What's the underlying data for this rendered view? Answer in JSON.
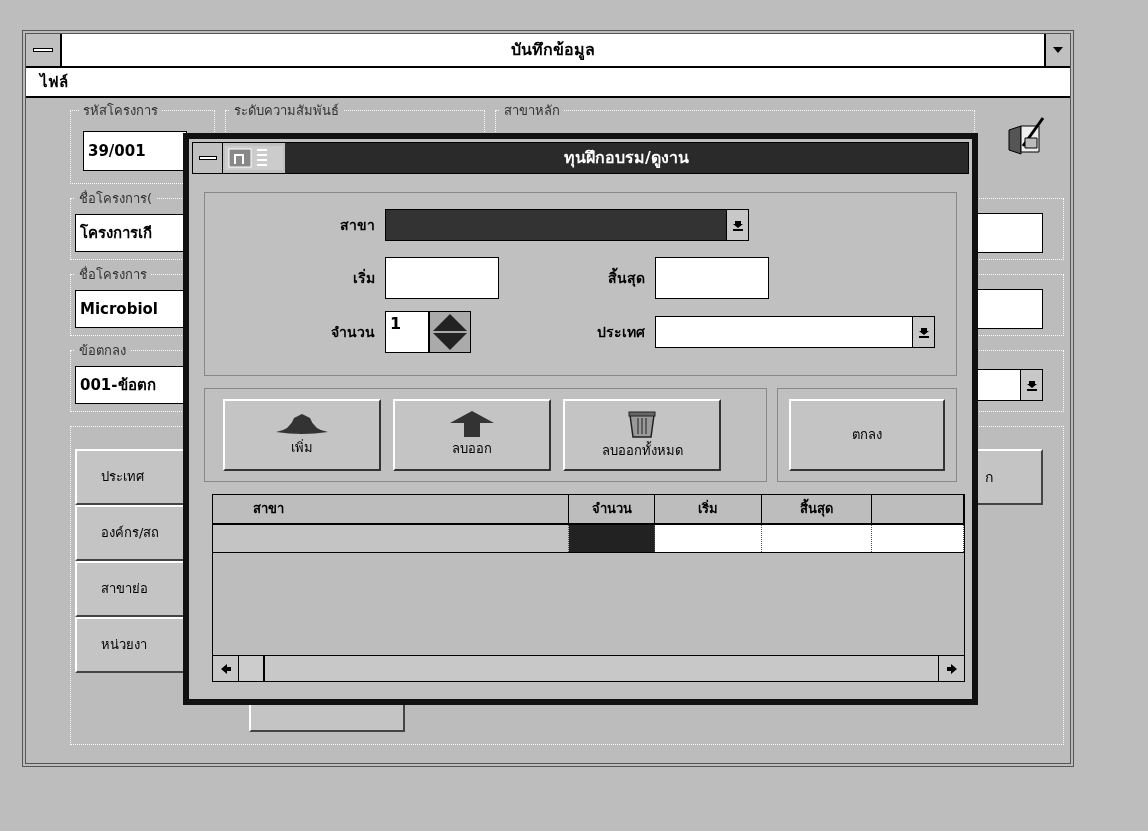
{
  "main_window": {
    "title": "บันทึกข้อมูล",
    "menu": [
      {
        "label": "ไฟล์"
      }
    ],
    "project_code": {
      "label": "รหัสโครงการ",
      "value": "39/001"
    },
    "level_label": "ระดับความสัมพันธ์",
    "main_branch_label": "สาขาหลัก",
    "project_name_th": {
      "label": "ชื่อโครงการ(",
      "value": "โครงการเกี"
    },
    "project_name_en": {
      "label": "ชื่อโครงการ",
      "value": "Microbiol"
    },
    "agreement": {
      "label": "ข้อตกลง",
      "value": "001-ข้อตก"
    },
    "buttons": [
      "ประเทศ",
      "องค์กร/สถ",
      "สาขาย่อ",
      "หน่วยงา"
    ],
    "side_button": "ก"
  },
  "dialog": {
    "title": "ทุนฝึกอบรม/ดูงาน",
    "branch": {
      "label": "สาขา",
      "highlighted": true
    },
    "start": {
      "label": "เริ่ม"
    },
    "end": {
      "label": "สิ้นสุด"
    },
    "count": {
      "label": "จำนวน",
      "value": "1"
    },
    "country": {
      "label": "ประเทศ",
      "highlighted": false
    },
    "buttons": [
      {
        "label": "เพิ่ม",
        "kind": "add"
      },
      {
        "label": "ลบออก",
        "kind": "remove"
      },
      {
        "label": "ลบออกทั้งหมด",
        "kind": "clear"
      }
    ],
    "ok_button": "ตกลง",
    "table": {
      "columns": [
        "สาขา",
        "จำนวน",
        "เริ่ม",
        "สิ้นสุด"
      ],
      "rows": [
        {
          "cells": [
            {
              "selected": false
            },
            {
              "selected": true
            },
            {
              "selected": false
            },
            {
              "selected": false
            },
            {
              "selected": false
            }
          ]
        }
      ]
    }
  }
}
